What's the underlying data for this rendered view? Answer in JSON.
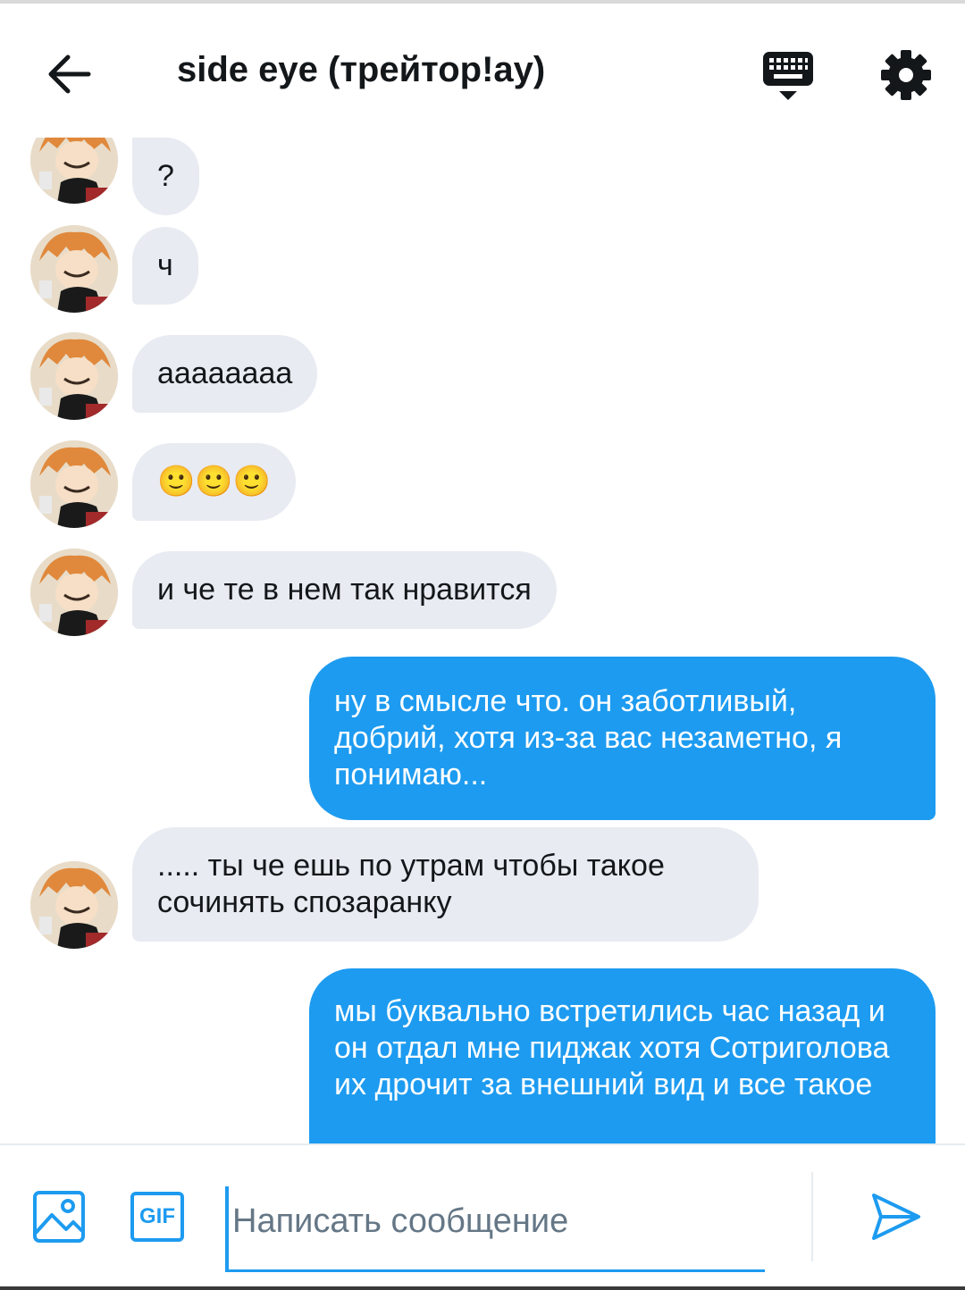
{
  "header": {
    "title": "side eye (трейтор!ay)",
    "back_icon": "arrow-left-icon",
    "keyboard_icon": "keyboard-icon",
    "settings_icon": "gear-icon"
  },
  "messages": [
    {
      "dir": "in",
      "text": "?"
    },
    {
      "dir": "in",
      "text": "ч"
    },
    {
      "dir": "in",
      "text": "ааааааaа"
    },
    {
      "dir": "in",
      "text": "🙂🙂🙂"
    },
    {
      "dir": "in",
      "text": "и че те в нем так нравится"
    },
    {
      "dir": "out",
      "text": "ну в смысле что. он заботливый, добрий, хотя из-за вас незаметно, я понимаю..."
    },
    {
      "dir": "in",
      "text": "..... ты че ешь по утрам чтобы такое сочинять спозаранку"
    },
    {
      "dir": "out",
      "text": "мы буквально встретились час назад и он отдал мне пиджак хотя Сотриголова их дрочит за внешний вид и все такое"
    }
  ],
  "composer": {
    "placeholder": "Написать сообщение",
    "value": "",
    "image_icon": "image-icon",
    "gif_label": "GIF",
    "send_icon": "send-icon"
  },
  "colors": {
    "accent": "#1d9bf0",
    "incoming_bubble": "#e8ebf1",
    "text": "#14171a",
    "placeholder": "#657786"
  }
}
